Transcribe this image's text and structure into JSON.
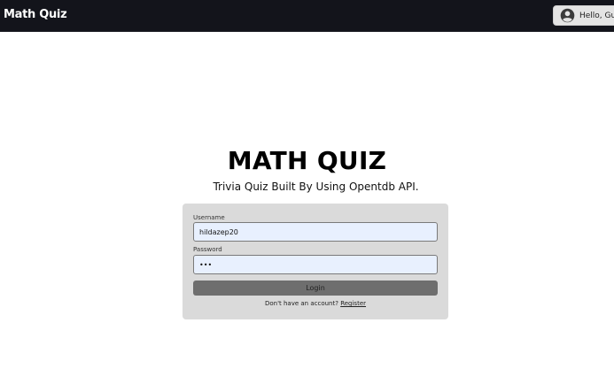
{
  "navbar": {
    "brand": "Math Quiz",
    "user_button_label": "Hello, Guest",
    "user_icon": "account-circle-icon"
  },
  "hero": {
    "title": "MATH QUIZ",
    "subtitle": "Trivia Quiz Built By Using Opentdb API."
  },
  "login_form": {
    "username_label": "Username",
    "username_value": "hildazep20",
    "password_label": "Password",
    "password_value": "•••",
    "login_button_label": "Login",
    "register_prompt": "Don't have an account?",
    "register_link": "Register"
  }
}
